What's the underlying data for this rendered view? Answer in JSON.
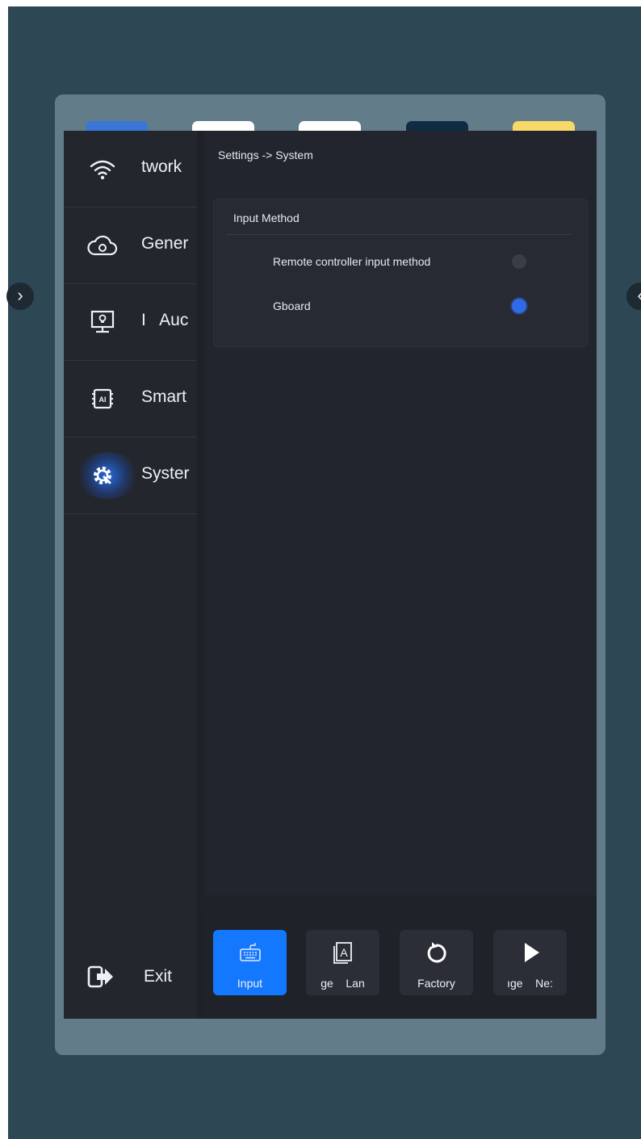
{
  "breadcrumb": "Settings -> System",
  "sidebar": {
    "items": [
      {
        "label": "twork",
        "icon": "wifi-icon"
      },
      {
        "label": "Gener",
        "icon": "cloud-settings-icon"
      },
      {
        "label": "I   Auc",
        "icon": "monitor-bulb-icon"
      },
      {
        "label": "Smart",
        "icon": "ai-chip-icon"
      },
      {
        "label": "Syster",
        "icon": "system-gear-icon"
      }
    ],
    "exit_label": "Exit"
  },
  "panel": {
    "title": "Input Method",
    "options": [
      {
        "label": "Remote controller input method",
        "selected": false
      },
      {
        "label": "Gboard",
        "selected": true
      }
    ]
  },
  "toolbar": {
    "buttons": [
      {
        "label": "Input",
        "icon": "keyboard-icon"
      },
      {
        "label": "ge    Lan",
        "icon": "language-icon"
      },
      {
        "label": "Factory",
        "icon": "refresh-icon"
      },
      {
        "label": "ıge    Ne:",
        "icon": "play-icon"
      }
    ]
  },
  "colors": {
    "background": "#2d4754",
    "accent": "#1478ff",
    "radio_selected": "#2f6be6"
  }
}
